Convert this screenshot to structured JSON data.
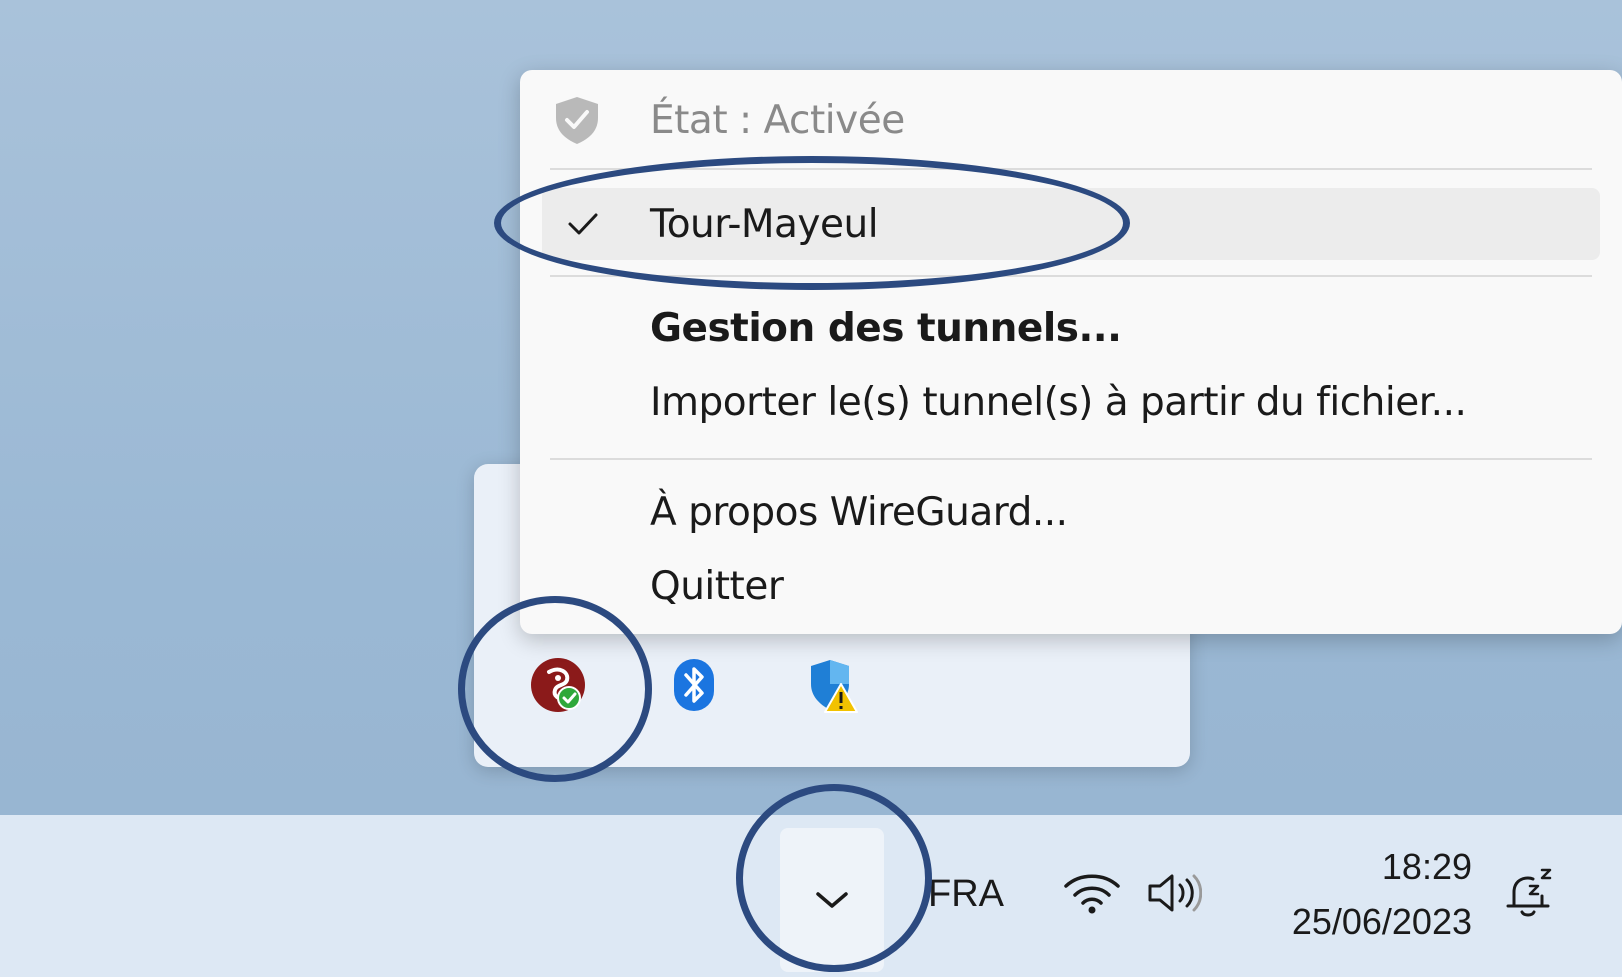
{
  "context_menu": {
    "status_label": "État : Activée",
    "tunnel_name": "Tour-Mayeul",
    "manage_tunnels_label": "Gestion des tunnels...",
    "import_label": "Importer le(s) tunnel(s) à partir du fichier...",
    "about_label": "À propos WireGuard...",
    "quit_label": "Quitter"
  },
  "tray_icons": {
    "icons": [
      "wireguard-icon",
      "bluetooth-icon",
      "windows-security-warning-icon"
    ]
  },
  "taskbar": {
    "language": "FRA",
    "time": "18:29",
    "date": "25/06/2023"
  },
  "colors": {
    "annotation": "#2c4a80",
    "wireguard_red": "#8b1a1a",
    "bluetooth_blue": "#1b75e0",
    "security_blue": "#1f7fd6",
    "warning_yellow": "#f2c200"
  }
}
